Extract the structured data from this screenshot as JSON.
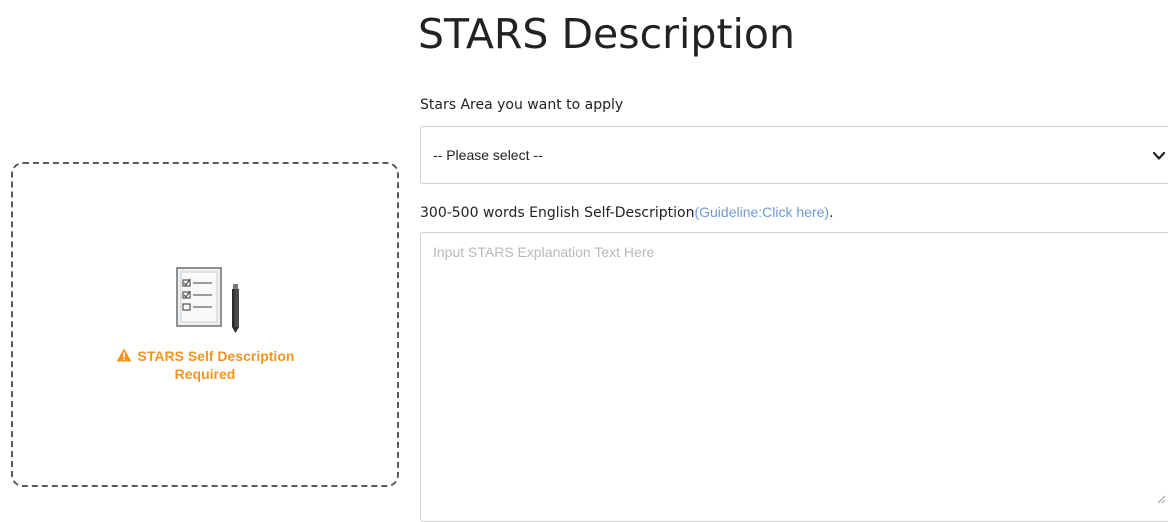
{
  "status_card": {
    "icon": "checklist-pencil-icon",
    "warning_icon": "warning-triangle-icon",
    "message_line1": "STARS Self Description",
    "message_line2": "Required",
    "color": "#f2951e"
  },
  "form": {
    "title": "STARS Description",
    "area_label": "Stars Area you want to apply",
    "area_select": {
      "selected": "-- Please select --",
      "icon": "chevron-down-icon"
    },
    "description_label": "300-500 words English Self-Description",
    "guideline_link": "(Guideline:Click here)",
    "description_label_end": ".",
    "description_placeholder": "Input STARS Explanation Text Here",
    "description_value": ""
  },
  "colors": {
    "link": "#6c9ad6",
    "warning": "#f2951e",
    "border": "#cfcfcf"
  }
}
